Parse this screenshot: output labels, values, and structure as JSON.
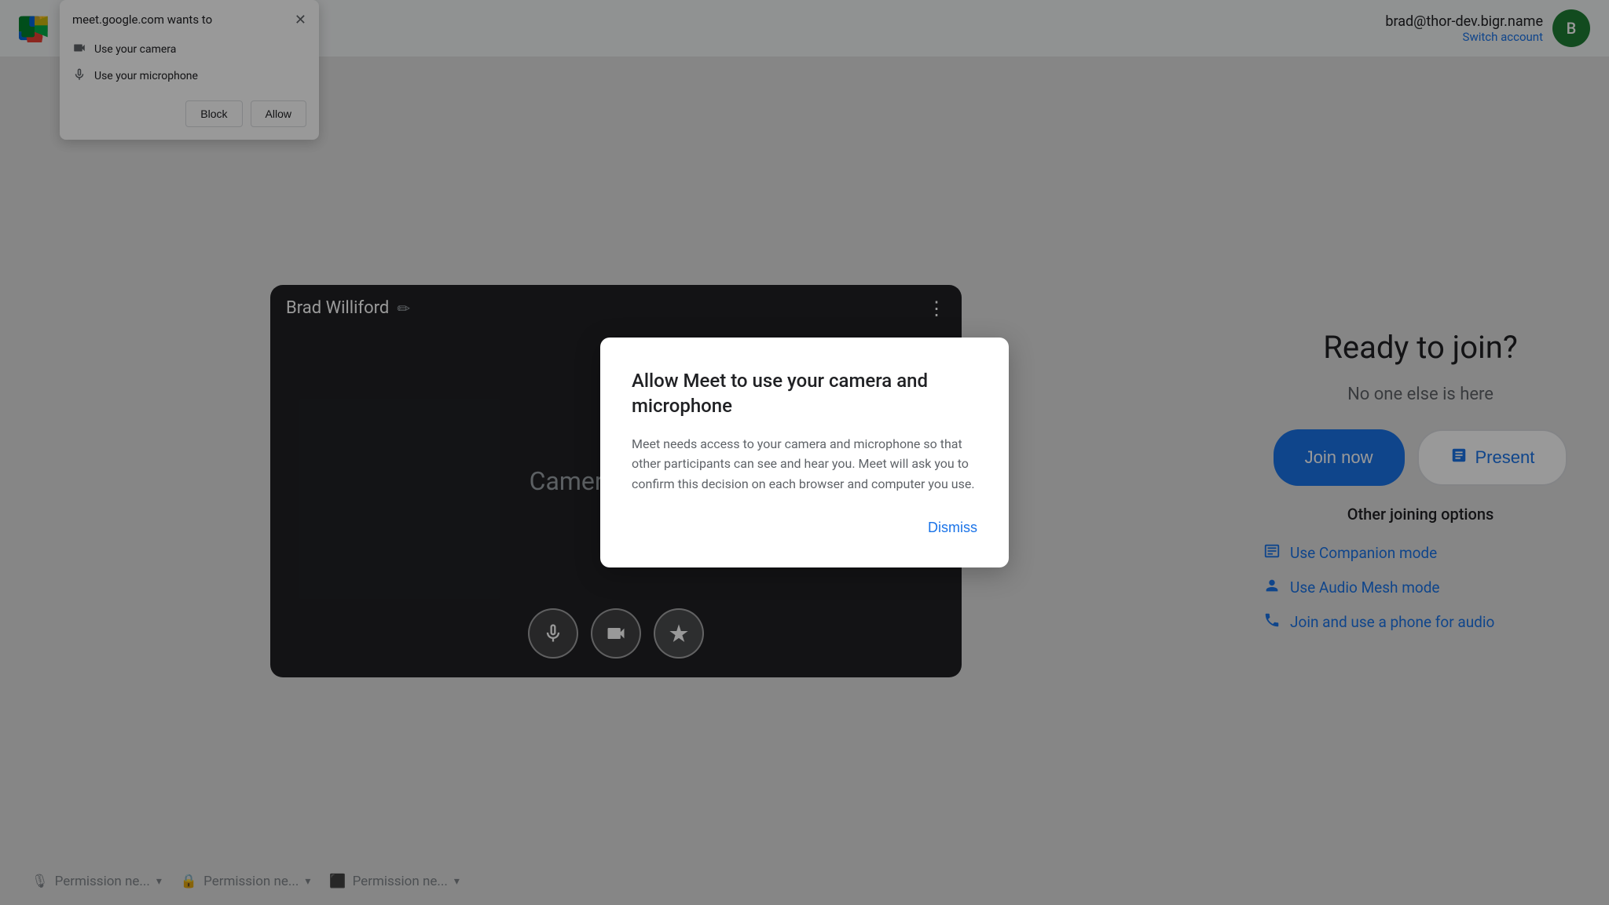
{
  "header": {
    "logo_alt": "Google Meet",
    "user_email": "brad@thor-dev.bigr.name",
    "switch_account_label": "Switch account",
    "avatar_initial": "B"
  },
  "video_preview": {
    "user_name": "Brad Williford",
    "camera_status_text": "Camera is sta...",
    "edit_icon": "✏",
    "more_icon": "⋮",
    "mic_icon": "🎤",
    "camera_icon": "⬛",
    "effects_icon": "✦"
  },
  "permission_bar": {
    "items": [
      {
        "icon": "🎙",
        "label": "Permission ne..."
      },
      {
        "icon": "🔒",
        "label": "Permission ne..."
      },
      {
        "icon": "⬛",
        "label": "Permission ne..."
      }
    ]
  },
  "join_panel": {
    "ready_title": "Ready to join?",
    "no_one_text": "No one else is here",
    "join_now_label": "Join now",
    "present_label": "Present",
    "other_options_title": "Other joining options",
    "options": [
      {
        "icon": "🖥",
        "label": "Use Companion mode"
      },
      {
        "icon": "👤",
        "label": "Use Audio Mesh mode"
      },
      {
        "icon": "📞",
        "label": "Join and use a phone for audio"
      }
    ]
  },
  "browser_popup": {
    "title": "meet.google.com wants to",
    "items": [
      {
        "icon": "📹",
        "label": "Use your camera"
      },
      {
        "icon": "🎤",
        "label": "Use your microphone"
      }
    ],
    "block_label": "Block",
    "allow_label": "Allow"
  },
  "modal": {
    "title": "Allow Meet to use your camera and microphone",
    "body": "Meet needs access to your camera and microphone so that other participants can see and hear you. Meet will ask you to confirm this decision on each browser and computer you use.",
    "dismiss_label": "Dismiss"
  }
}
